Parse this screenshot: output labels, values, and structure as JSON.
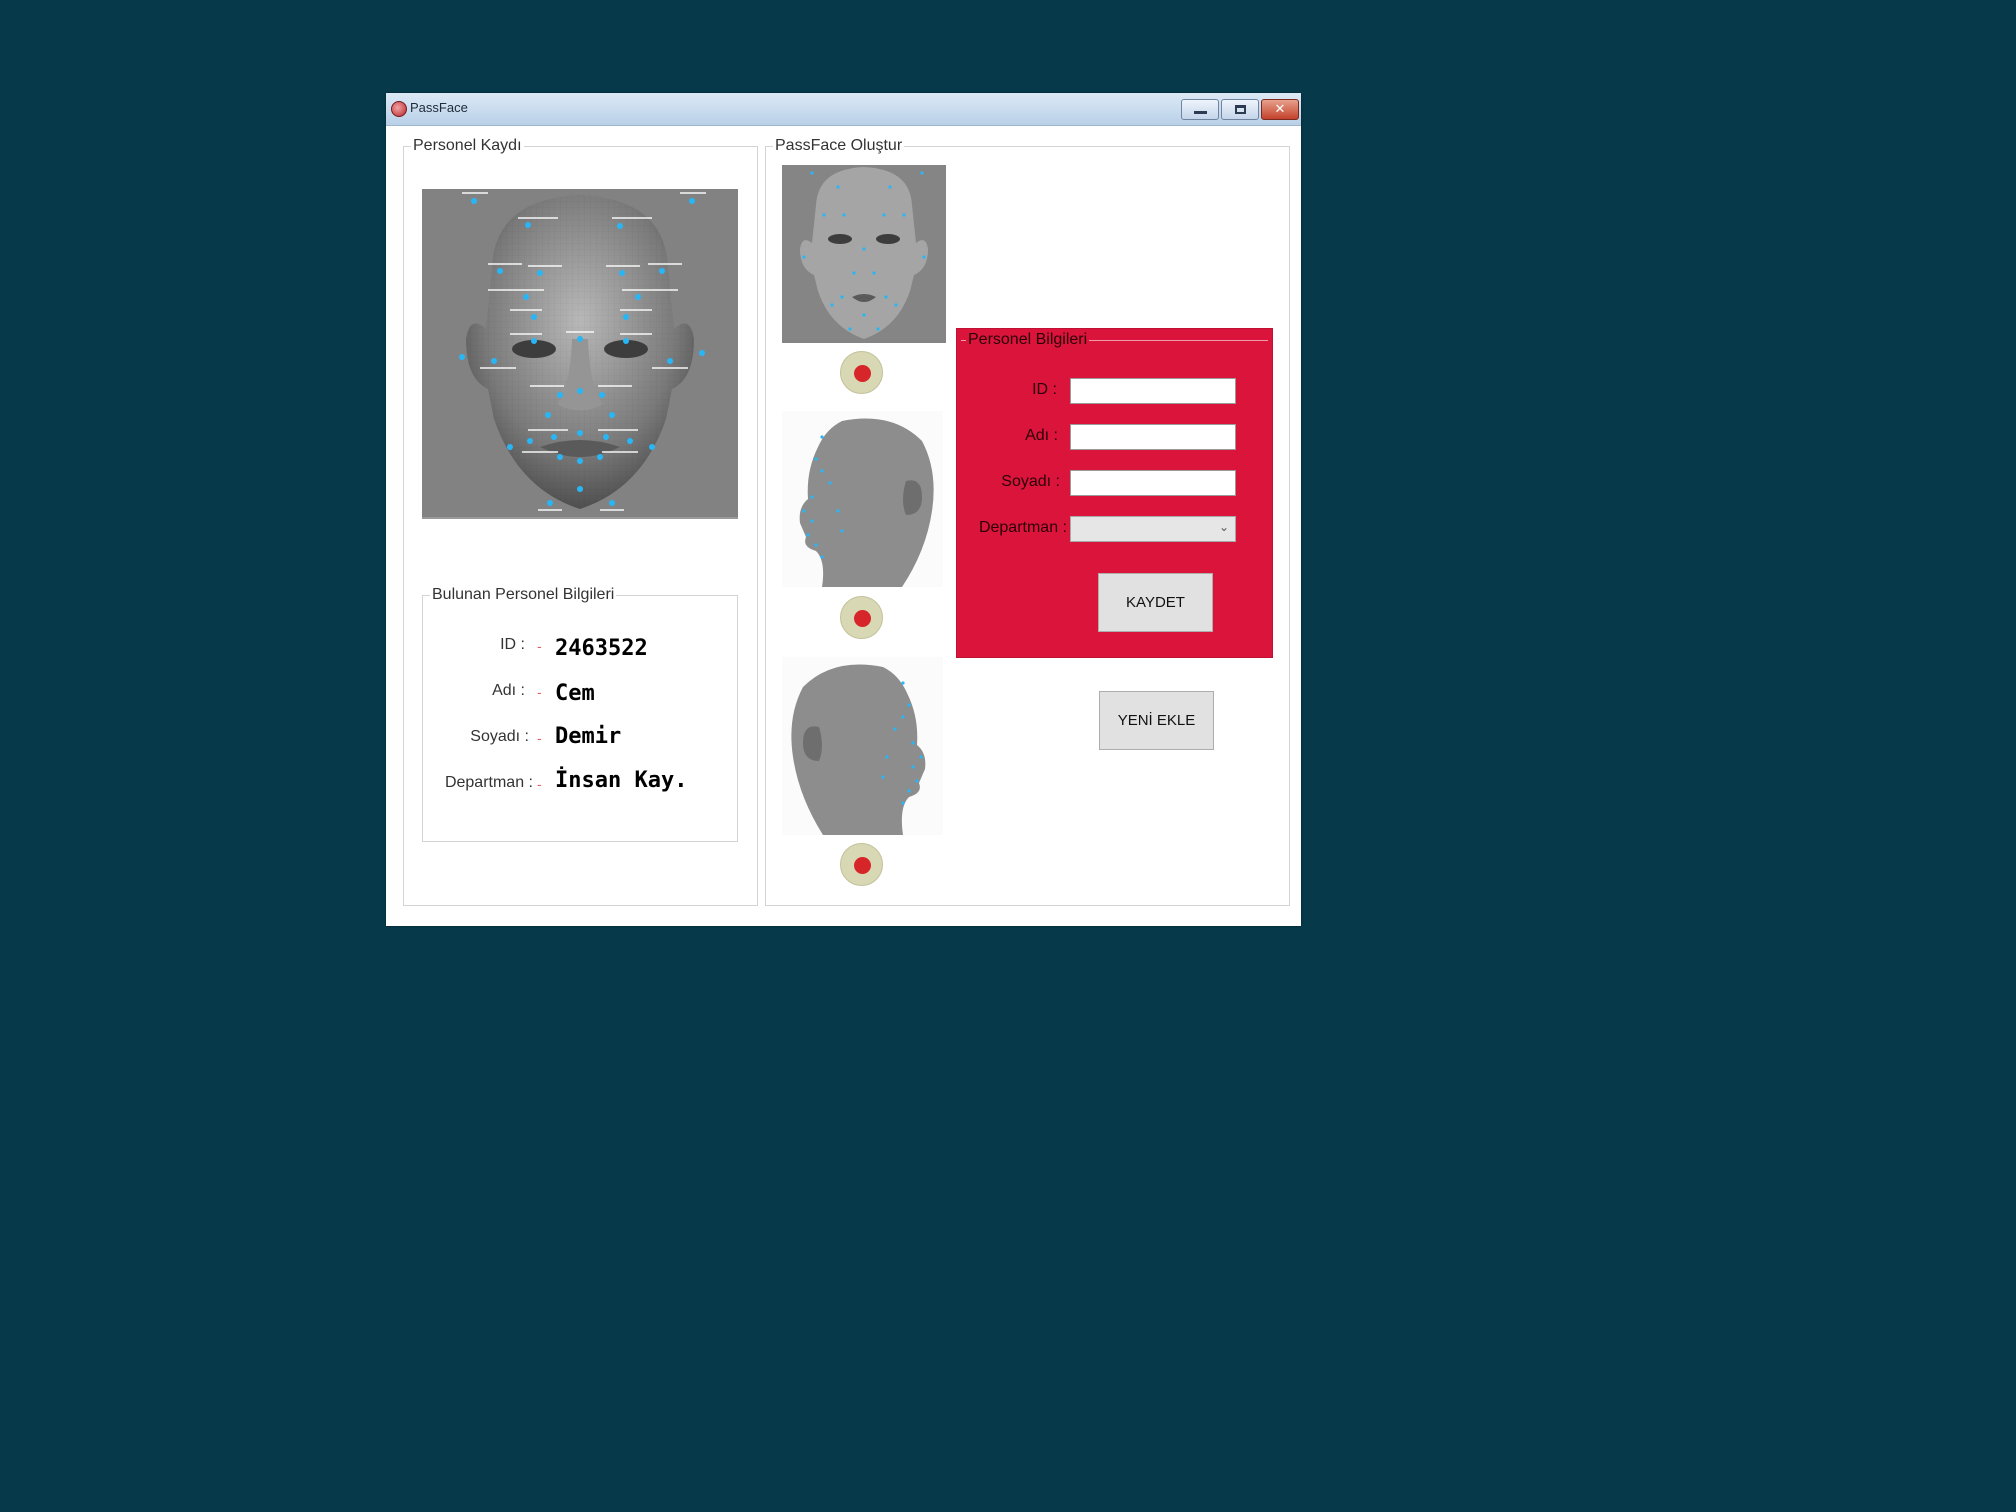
{
  "window": {
    "title": "PassFace"
  },
  "personel_kaydi": {
    "label": "Personel Kaydı"
  },
  "bulunan": {
    "label": "Bulunan Personel Bilgileri",
    "rows": [
      {
        "label": "ID :",
        "value": "2463522"
      },
      {
        "label": "Adı :",
        "value": "Cem"
      },
      {
        "label": "Soyadı :",
        "value": "Demir"
      },
      {
        "label": "Departman :",
        "value": "İnsan Kay."
      }
    ],
    "dash": "-"
  },
  "passface": {
    "label": "PassFace Oluştur"
  },
  "personel_bilgileri": {
    "label": "Personel Bilgileri",
    "id_label": "ID :",
    "adi_label": "Adı :",
    "soyadi_label": "Soyadı :",
    "departman_label": "Departman :",
    "id_value": "",
    "adi_value": "",
    "soyadi_value": "",
    "departman_value": "",
    "save_label": "KAYDET"
  },
  "yeni_ekle_label": "YENİ EKLE",
  "colors": {
    "desktop": "#063a4b",
    "panel_red": "#db143c",
    "landmark": "#29b6f6",
    "record": "#d6262a"
  },
  "icons": [
    "app-icon",
    "minimize-icon",
    "maximize-icon",
    "close-icon",
    "face-mesh",
    "record-icon"
  ]
}
